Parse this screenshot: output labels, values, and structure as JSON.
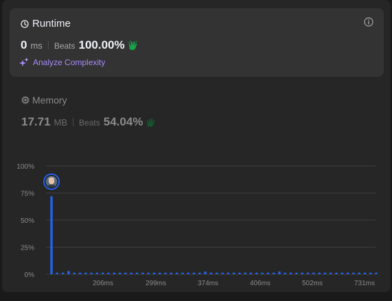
{
  "runtime": {
    "title": "Runtime",
    "value": "0",
    "unit": "ms",
    "beats_label": "Beats",
    "beats_value": "100.00%",
    "analyze_label": "Analyze Complexity"
  },
  "memory": {
    "title": "Memory",
    "value": "17.71",
    "unit": "MB",
    "beats_label": "Beats",
    "beats_value": "54.04%"
  },
  "colors": {
    "bar": "#2563eb",
    "accent_purple": "#a78bfa",
    "clap_green": "#16a34a"
  },
  "chart_data": {
    "type": "bar",
    "y_tick_labels": [
      "100%",
      "75%",
      "50%",
      "25%",
      "0%"
    ],
    "ylim": [
      0,
      100
    ],
    "x_tick_labels": [
      "206ms",
      "299ms",
      "374ms",
      "406ms",
      "502ms",
      "731ms"
    ],
    "values": [
      72,
      1.5,
      1.5,
      3,
      1.5,
      1.5,
      1.5,
      1.5,
      1.5,
      1.5,
      1.5,
      1.5,
      1.5,
      1.5,
      1.5,
      1.5,
      1.5,
      1.5,
      1.5,
      1.5,
      1.5,
      1.5,
      1.5,
      1.5,
      1.5,
      1.5,
      1.5,
      2.5,
      1.5,
      1.5,
      1.5,
      1.5,
      1.5,
      1.5,
      1.5,
      1.5,
      1.5,
      1.5,
      1.5,
      1.5,
      2.5,
      1.5,
      1.5,
      1.5,
      1.5,
      1.5,
      1.5,
      1.5,
      1.5,
      1.5,
      1.5,
      1.5,
      1.5,
      1.5,
      1.5,
      1.5,
      1.5,
      1.5
    ],
    "highlighted_index": 0,
    "grid": true
  }
}
